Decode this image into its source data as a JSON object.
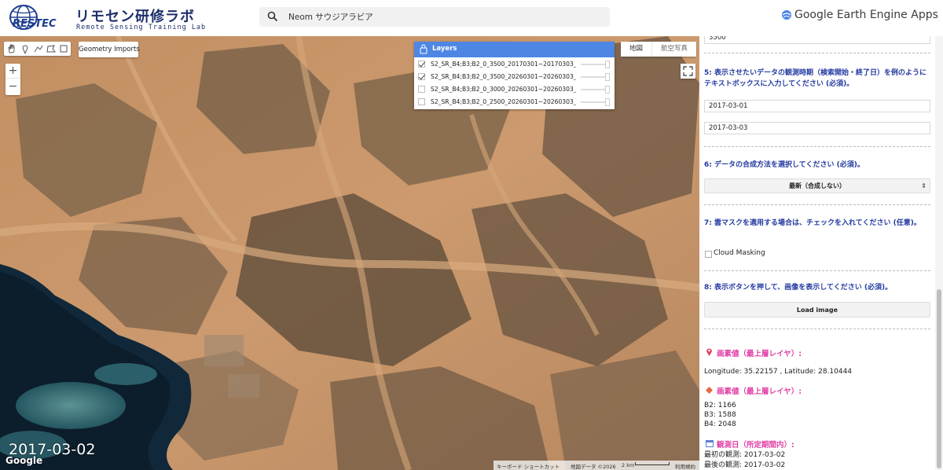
{
  "header": {
    "logo_title": "リモセン研修ラボ",
    "logo_subtitle": "Remote Sensing Training Lab",
    "logo_brand": "RESTEC",
    "search_text": "Neom サウジアラビア",
    "app_name": "Google Earth Engine Apps"
  },
  "map": {
    "geometry_imports_label": "Geometry Imports",
    "zoom_in": "+",
    "zoom_out": "−",
    "map_type_map": "地図",
    "map_type_satellite": "航空写真",
    "date_overlay": "2017-03-02",
    "google_logo": "Google",
    "attribution": {
      "shortcuts": "キーボード ショートカット",
      "map_data": "地図データ ©2026",
      "scale": "2 km",
      "terms": "利用規約"
    },
    "layers": {
      "title": "Layers",
      "items": [
        {
          "name": "S2_SR_B4;B3;B2_0_3500_20170301~20170303_...",
          "checked": true
        },
        {
          "name": "S2_SR_B4;B3;B2_0_3500_20260301~20260303_...",
          "checked": true
        },
        {
          "name": "S2_SR_B4;B3;B2_0_3000_20260301~20260303_...",
          "checked": false
        },
        {
          "name": "S2_SR_B4;B3;B2_0_2500_20260301~20260303_...",
          "checked": false
        }
      ]
    }
  },
  "panel": {
    "max_value_field": "3500",
    "q5": "5: 表示させたいデータの観測時期（検索開始・終了日）を例のようにテキストボックスに入力してください (必須)。",
    "start_date": "2017-03-01",
    "end_date": "2017-03-03",
    "q6": "6: データの合成方法を選択してください (必須)。",
    "composite_method": "最新（合成しない）",
    "q7": "7: 雲マスクを適用する場合は、チェックを入れてください (任意)。",
    "cloud_masking_label": "Cloud Masking",
    "cloud_masking_checked": false,
    "q8": "8: 表示ボタンを押して、画像を表示してください (必須)。",
    "load_button": "Load image",
    "pixel_title_1": "画素値（最上層レイヤ）:",
    "coordinates": "Longitude: 35.22157 , Latitude: 28.10444",
    "pixel_title_2": "画素値（最上層レイヤ）:",
    "band_b2": "B2: 1166",
    "band_b3": "B3: 1588",
    "band_b4": "B4: 2048",
    "obs_title": "観測日（所定期間内）:",
    "first_obs": "最初の観測: 2017-03-02",
    "last_obs": "最後の観測: 2017-03-02"
  },
  "colors": {
    "question_text": "#233aa0",
    "pixel_title": "#e03fa6",
    "layers_header": "#4e86e4",
    "desert": "#c99568",
    "rock": "#6e5a44",
    "sea": "#0e2233"
  },
  "icons": [
    "search-icon",
    "gee-logo-icon",
    "pan-hand-icon",
    "point-icon",
    "line-icon",
    "polygon-icon",
    "rectangle-icon",
    "lock-icon",
    "fullscreen-icon",
    "pin-icon",
    "diamond-icon",
    "calendar-icon"
  ]
}
